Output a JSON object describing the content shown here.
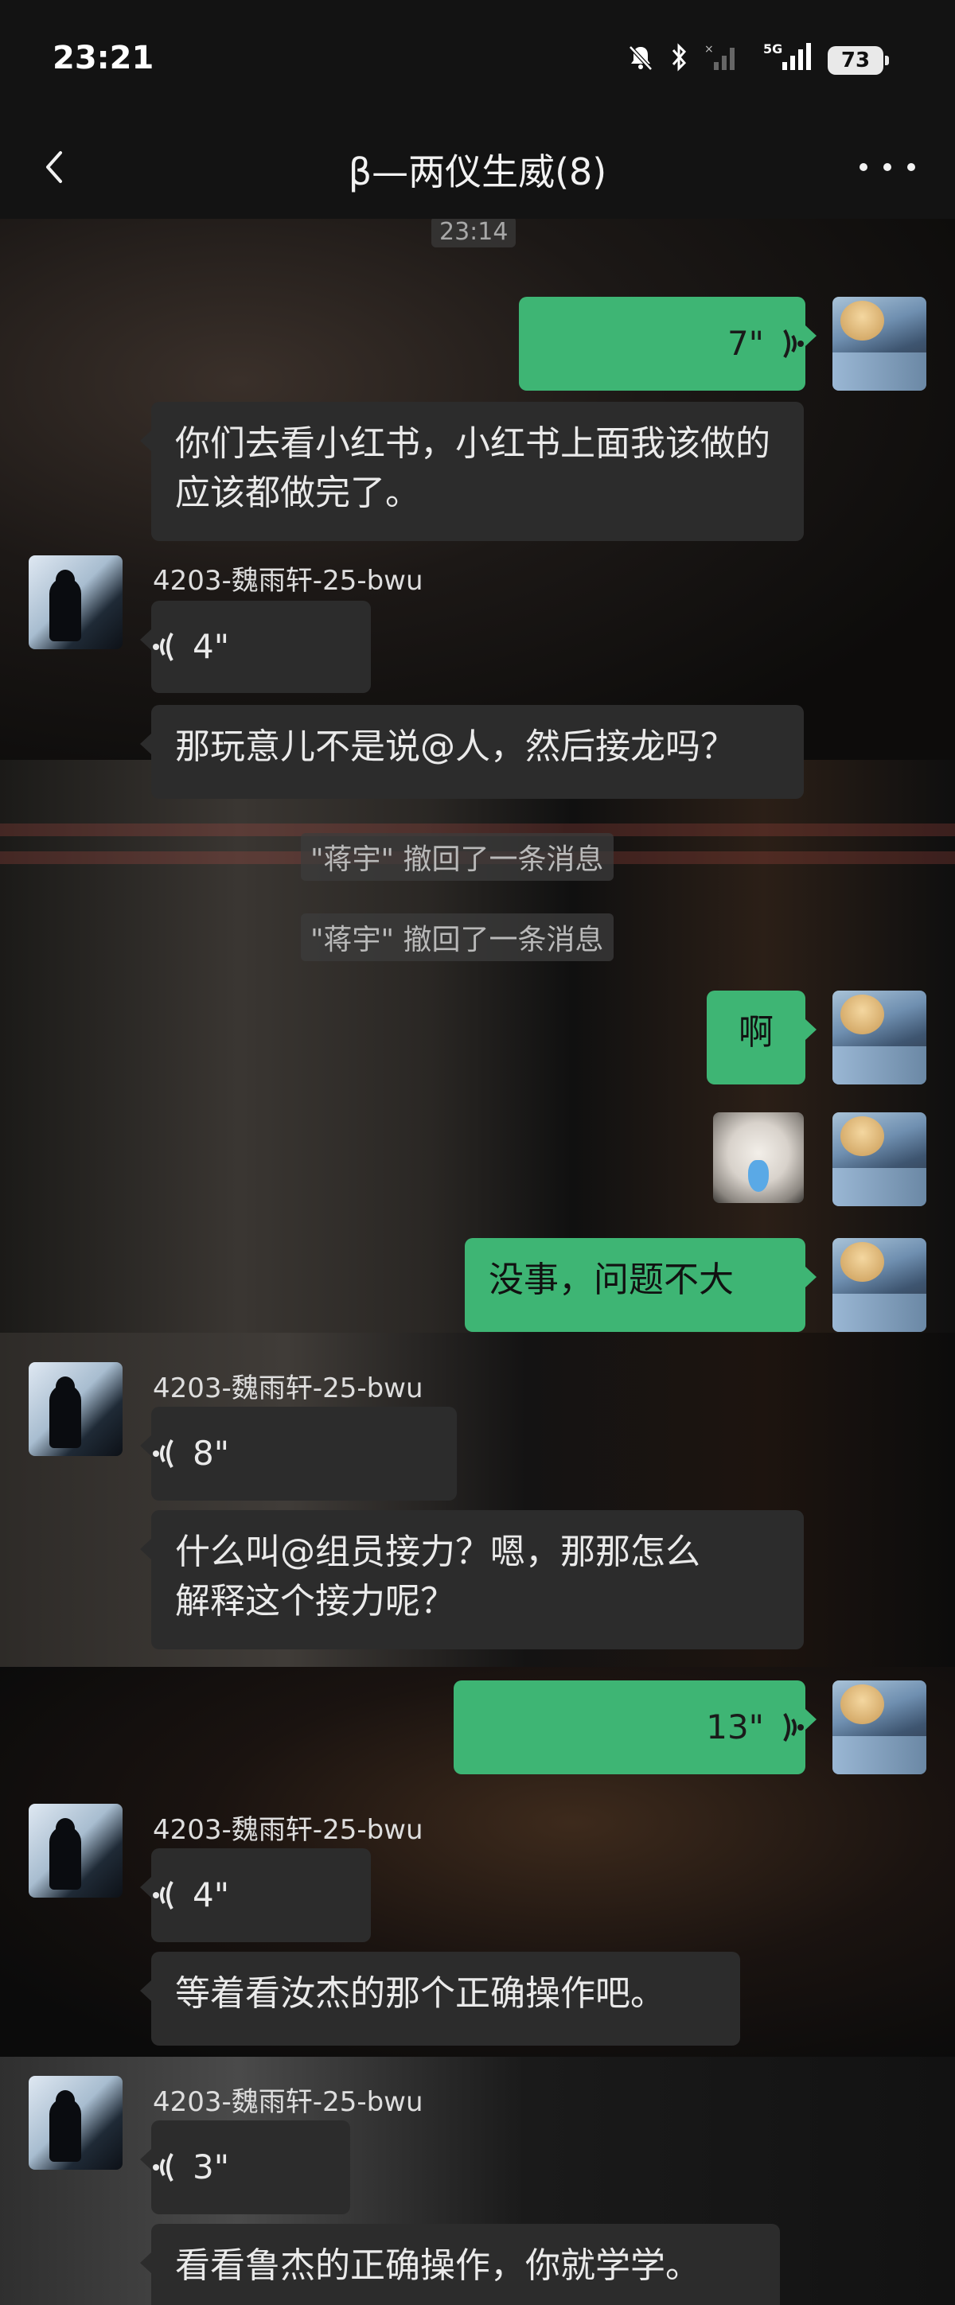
{
  "status_bar": {
    "time": "23:21",
    "signal_label": "5G",
    "battery": "73"
  },
  "nav": {
    "title": "β—两仪生威(8)"
  },
  "chat": {
    "timestamp": "23:14",
    "messages": [
      {
        "id": "m1",
        "from": "self",
        "type": "voice",
        "duration": "7\""
      },
      {
        "id": "m2",
        "from": "other",
        "type": "text",
        "text": "你们去看小红书，小红书上面我该做的应该都做完了。"
      },
      {
        "id": "m3",
        "from": "other",
        "sender": "4203-魏雨轩-25-bwu",
        "type": "voice",
        "duration": "4\""
      },
      {
        "id": "m4",
        "from": "other",
        "type": "text",
        "text": "那玩意儿不是说@人，然后接龙吗？"
      },
      {
        "id": "m5",
        "type": "system",
        "text": "\"蒋宇\" 撤回了一条消息"
      },
      {
        "id": "m6",
        "type": "system",
        "text": "\"蒋宇\" 撤回了一条消息"
      },
      {
        "id": "m7",
        "from": "self",
        "type": "text",
        "text": "啊"
      },
      {
        "id": "m8",
        "from": "self",
        "type": "sticker",
        "icon": "crying-cat-sticker"
      },
      {
        "id": "m9",
        "from": "self",
        "type": "text",
        "text": "没事，问题不大"
      },
      {
        "id": "m10",
        "from": "other",
        "sender": "4203-魏雨轩-25-bwu",
        "type": "voice",
        "duration": "8\""
      },
      {
        "id": "m11",
        "from": "other",
        "type": "text",
        "line1": "什么叫@组员接力？嗯，那那怎么",
        "line2": "解释这个接力呢？"
      },
      {
        "id": "m12",
        "from": "self",
        "type": "voice",
        "duration": "13\""
      },
      {
        "id": "m13",
        "from": "other",
        "sender": "4203-魏雨轩-25-bwu",
        "type": "voice",
        "duration": "4\""
      },
      {
        "id": "m14",
        "from": "other",
        "type": "text",
        "text": "等着看汝杰的那个正确操作吧。"
      },
      {
        "id": "m15",
        "from": "other",
        "sender": "4203-魏雨轩-25-bwu",
        "type": "voice",
        "duration": "3\""
      },
      {
        "id": "m16",
        "from": "other",
        "type": "text",
        "text": "看看鲁杰的正确操作，你就学学。"
      }
    ]
  },
  "colors": {
    "self_bubble": "#3eb574",
    "other_bubble": "#2c2c2c",
    "bar_background": "#131313"
  }
}
